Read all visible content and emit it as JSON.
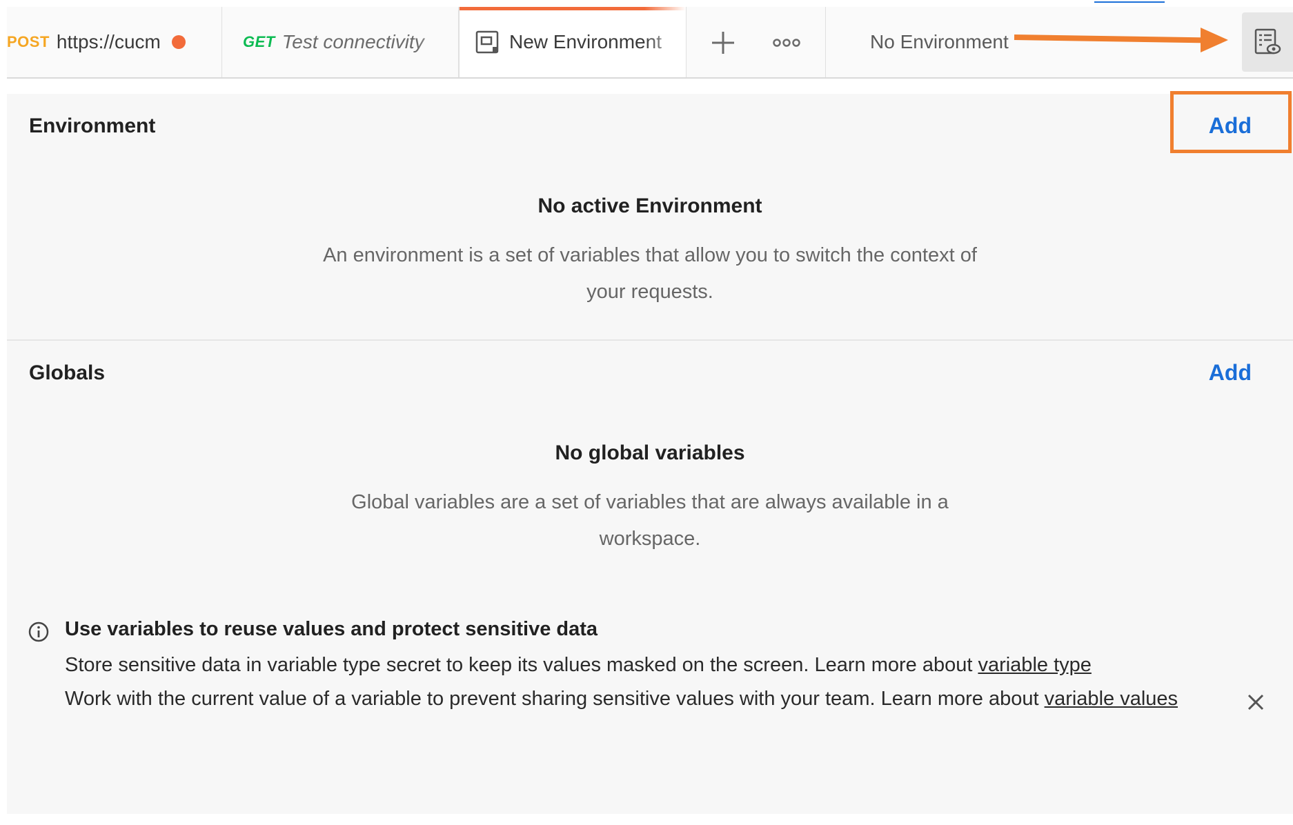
{
  "tabs": [
    {
      "method": "POST",
      "label": "https://cucm",
      "unsaved": true
    },
    {
      "method": "GET",
      "label": "Test connectivity"
    },
    {
      "label": "New Environment",
      "active": true,
      "icon": "environment-icon"
    }
  ],
  "toolbar": {
    "new_tab_icon": "plus-icon",
    "more_icon": "ellipsis-icon",
    "environment_selector": "No Environment",
    "quick_look_icon": "environment-quick-look-icon"
  },
  "environment": {
    "heading": "Environment",
    "add_label": "Add",
    "empty_title": "No active Environment",
    "empty_desc": "An environment is a set of variables that allow you to switch the context of your requests."
  },
  "globals": {
    "heading": "Globals",
    "add_label": "Add",
    "empty_title": "No global variables",
    "empty_desc": "Global variables are a set of variables that are always available in a workspace."
  },
  "info_banner": {
    "icon": "info-icon",
    "title": "Use variables to reuse values and protect sensitive data",
    "line1_text": "Store sensitive data in variable type secret to keep its values masked on the screen. Learn more about ",
    "line1_link": "variable type",
    "line2_text": "Work with the current value of a variable to prevent sharing sensitive values with your team. Learn more about ",
    "line2_link": "variable values",
    "close_icon": "close-icon"
  },
  "colors": {
    "accent": "#f26b3a",
    "annotation": "#f07f2f",
    "link": "#1a6ed8",
    "post": "#f5a623",
    "get": "#0cbb52"
  }
}
